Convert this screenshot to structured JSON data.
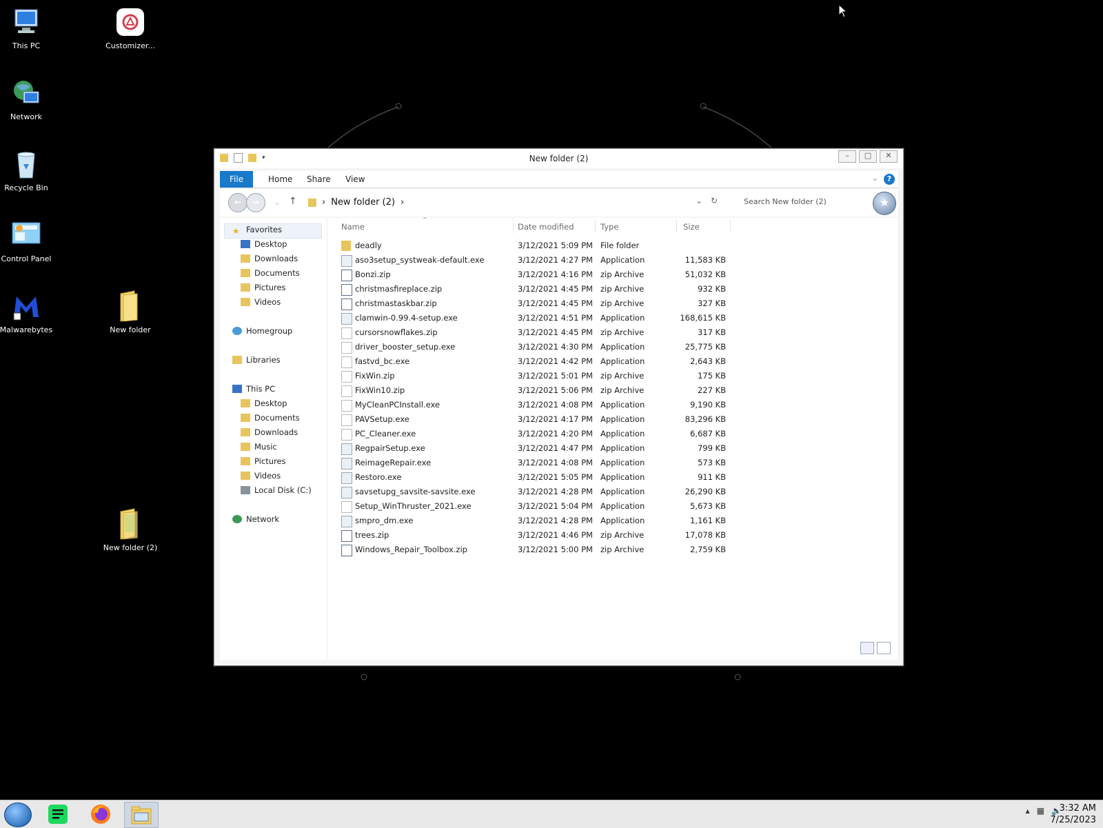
{
  "desktop": {
    "icons": [
      {
        "label": "This PC",
        "icon": "computer-icon"
      },
      {
        "label": "Customizer...",
        "icon": "customizer-icon"
      },
      {
        "label": "Network",
        "icon": "network-globe-icon"
      },
      {
        "label": "Recycle Bin",
        "icon": "recycle-bin-icon"
      },
      {
        "label": "Control Panel",
        "icon": "control-panel-icon"
      },
      {
        "label": "Malwarebytes",
        "icon": "malwarebytes-icon"
      },
      {
        "label": "New folder",
        "icon": "folder-icon"
      },
      {
        "label": "New folder (2)",
        "icon": "folder-icon"
      }
    ]
  },
  "window": {
    "title": "New folder (2)",
    "ribbon_tabs": [
      "File",
      "Home",
      "Share",
      "View"
    ],
    "breadcrumb": "New folder (2)",
    "search_placeholder": "Search New folder (2)",
    "nav": {
      "favorites": "Favorites",
      "favorites_items": [
        "Desktop",
        "Downloads",
        "Documents",
        "Pictures",
        "Videos"
      ],
      "homegroup": "Homegroup",
      "libraries": "Libraries",
      "this_pc": "This PC",
      "this_pc_items": [
        "Desktop",
        "Documents",
        "Downloads",
        "Music",
        "Pictures",
        "Videos",
        "Local Disk (C:)"
      ],
      "network": "Network"
    },
    "columns": {
      "name": "Name",
      "date": "Date modified",
      "type": "Type",
      "size": "Size"
    },
    "files": [
      {
        "name": "deadly",
        "date": "3/12/2021 5:09 PM",
        "type": "File folder",
        "size": "",
        "kind": "folder"
      },
      {
        "name": "aso3setup_systweak-default.exe",
        "date": "3/12/2021 4:27 PM",
        "type": "Application",
        "size": "11,583 KB",
        "kind": "app"
      },
      {
        "name": "Bonzi.zip",
        "date": "3/12/2021 4:16 PM",
        "type": "zip Archive",
        "size": "51,032 KB",
        "kind": "zip"
      },
      {
        "name": "christmasfireplace.zip",
        "date": "3/12/2021 4:45 PM",
        "type": "zip Archive",
        "size": "932 KB",
        "kind": "zip"
      },
      {
        "name": "christmastaskbar.zip",
        "date": "3/12/2021 4:45 PM",
        "type": "zip Archive",
        "size": "327 KB",
        "kind": "zip"
      },
      {
        "name": "clamwin-0.99.4-setup.exe",
        "date": "3/12/2021 4:51 PM",
        "type": "Application",
        "size": "168,615 KB",
        "kind": "app"
      },
      {
        "name": "cursorsnowflakes.zip",
        "date": "3/12/2021 4:45 PM",
        "type": "zip Archive",
        "size": "317 KB",
        "kind": "plain"
      },
      {
        "name": "driver_booster_setup.exe",
        "date": "3/12/2021 4:30 PM",
        "type": "Application",
        "size": "25,775 KB",
        "kind": "plain"
      },
      {
        "name": "fastvd_bc.exe",
        "date": "3/12/2021 4:42 PM",
        "type": "Application",
        "size": "2,643 KB",
        "kind": "plain"
      },
      {
        "name": "FixWin.zip",
        "date": "3/12/2021 5:01 PM",
        "type": "zip Archive",
        "size": "175 KB",
        "kind": "plain"
      },
      {
        "name": "FixWin10.zip",
        "date": "3/12/2021 5:06 PM",
        "type": "zip Archive",
        "size": "227 KB",
        "kind": "plain"
      },
      {
        "name": "MyCleanPCInstall.exe",
        "date": "3/12/2021 4:08 PM",
        "type": "Application",
        "size": "9,190 KB",
        "kind": "plain"
      },
      {
        "name": "PAVSetup.exe",
        "date": "3/12/2021 4:17 PM",
        "type": "Application",
        "size": "83,296 KB",
        "kind": "plain"
      },
      {
        "name": "PC_Cleaner.exe",
        "date": "3/12/2021 4:20 PM",
        "type": "Application",
        "size": "6,687 KB",
        "kind": "plain"
      },
      {
        "name": "RegpairSetup.exe",
        "date": "3/12/2021 4:47 PM",
        "type": "Application",
        "size": "799 KB",
        "kind": "app"
      },
      {
        "name": "ReimageRepair.exe",
        "date": "3/12/2021 4:08 PM",
        "type": "Application",
        "size": "573 KB",
        "kind": "app"
      },
      {
        "name": "Restoro.exe",
        "date": "3/12/2021 5:05 PM",
        "type": "Application",
        "size": "911 KB",
        "kind": "app"
      },
      {
        "name": "savsetupg_savsite-savsite.exe",
        "date": "3/12/2021 4:28 PM",
        "type": "Application",
        "size": "26,290 KB",
        "kind": "app"
      },
      {
        "name": "Setup_WinThruster_2021.exe",
        "date": "3/12/2021 5:04 PM",
        "type": "Application",
        "size": "5,673 KB",
        "kind": "plain"
      },
      {
        "name": "smpro_dm.exe",
        "date": "3/12/2021 4:28 PM",
        "type": "Application",
        "size": "1,161 KB",
        "kind": "app"
      },
      {
        "name": "trees.zip",
        "date": "3/12/2021 4:46 PM",
        "type": "zip Archive",
        "size": "17,078 KB",
        "kind": "zip"
      },
      {
        "name": "Windows_Repair_Toolbox.zip",
        "date": "3/12/2021 5:00 PM",
        "type": "zip Archive",
        "size": "2,759 KB",
        "kind": "zip"
      }
    ]
  },
  "taskbar": {
    "apps": [
      "start-orb-icon",
      "notes-app-icon",
      "firefox-icon",
      "file-explorer-icon"
    ],
    "time": "3:32 AM",
    "date": "7/25/2023"
  },
  "colors": {
    "accent": "#1979ca",
    "desktop": "#000000",
    "taskbar": "#e8e8e8"
  }
}
